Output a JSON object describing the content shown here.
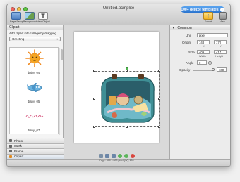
{
  "window": {
    "title": "Untitled.pcmplite"
  },
  "promo": {
    "label": "100+ deluxe templates"
  },
  "toolbar": {
    "page_setup": "Page Setup",
    "background": "Background",
    "new_object": "New Object",
    "export": "Export",
    "view": "View"
  },
  "left_panel": {
    "header": "Clipart",
    "instruction": "Add clipart into collage by dragging",
    "category": "Greeting",
    "items": [
      {
        "label": "baby_04"
      },
      {
        "label": "baby_05"
      },
      {
        "label": "baby_07"
      }
    ],
    "tabs": [
      {
        "label": "Photo"
      },
      {
        "label": "Mask"
      },
      {
        "label": "Frame"
      },
      {
        "label": "Clipart"
      }
    ]
  },
  "right_panel": {
    "header": "Common",
    "unit_label": "Unit",
    "unit_value": "pixel",
    "origin_label": "Origin",
    "origin_x": "148",
    "origin_y": "170",
    "origin_x_sub": "X",
    "origin_y_sub": "Y",
    "size_label": "Size",
    "width": "409",
    "height": "417",
    "width_sub": "Width",
    "height_sub": "Height",
    "angle_label": "Angle",
    "angle_value": "0",
    "opacity_label": "Opacity",
    "opacity_value": "100"
  },
  "status": {
    "text": "Page: 800 x 800 pixel (W), 100"
  },
  "colors": {
    "accent": "#2a74cf",
    "selection_handle": "#5bc25b"
  }
}
